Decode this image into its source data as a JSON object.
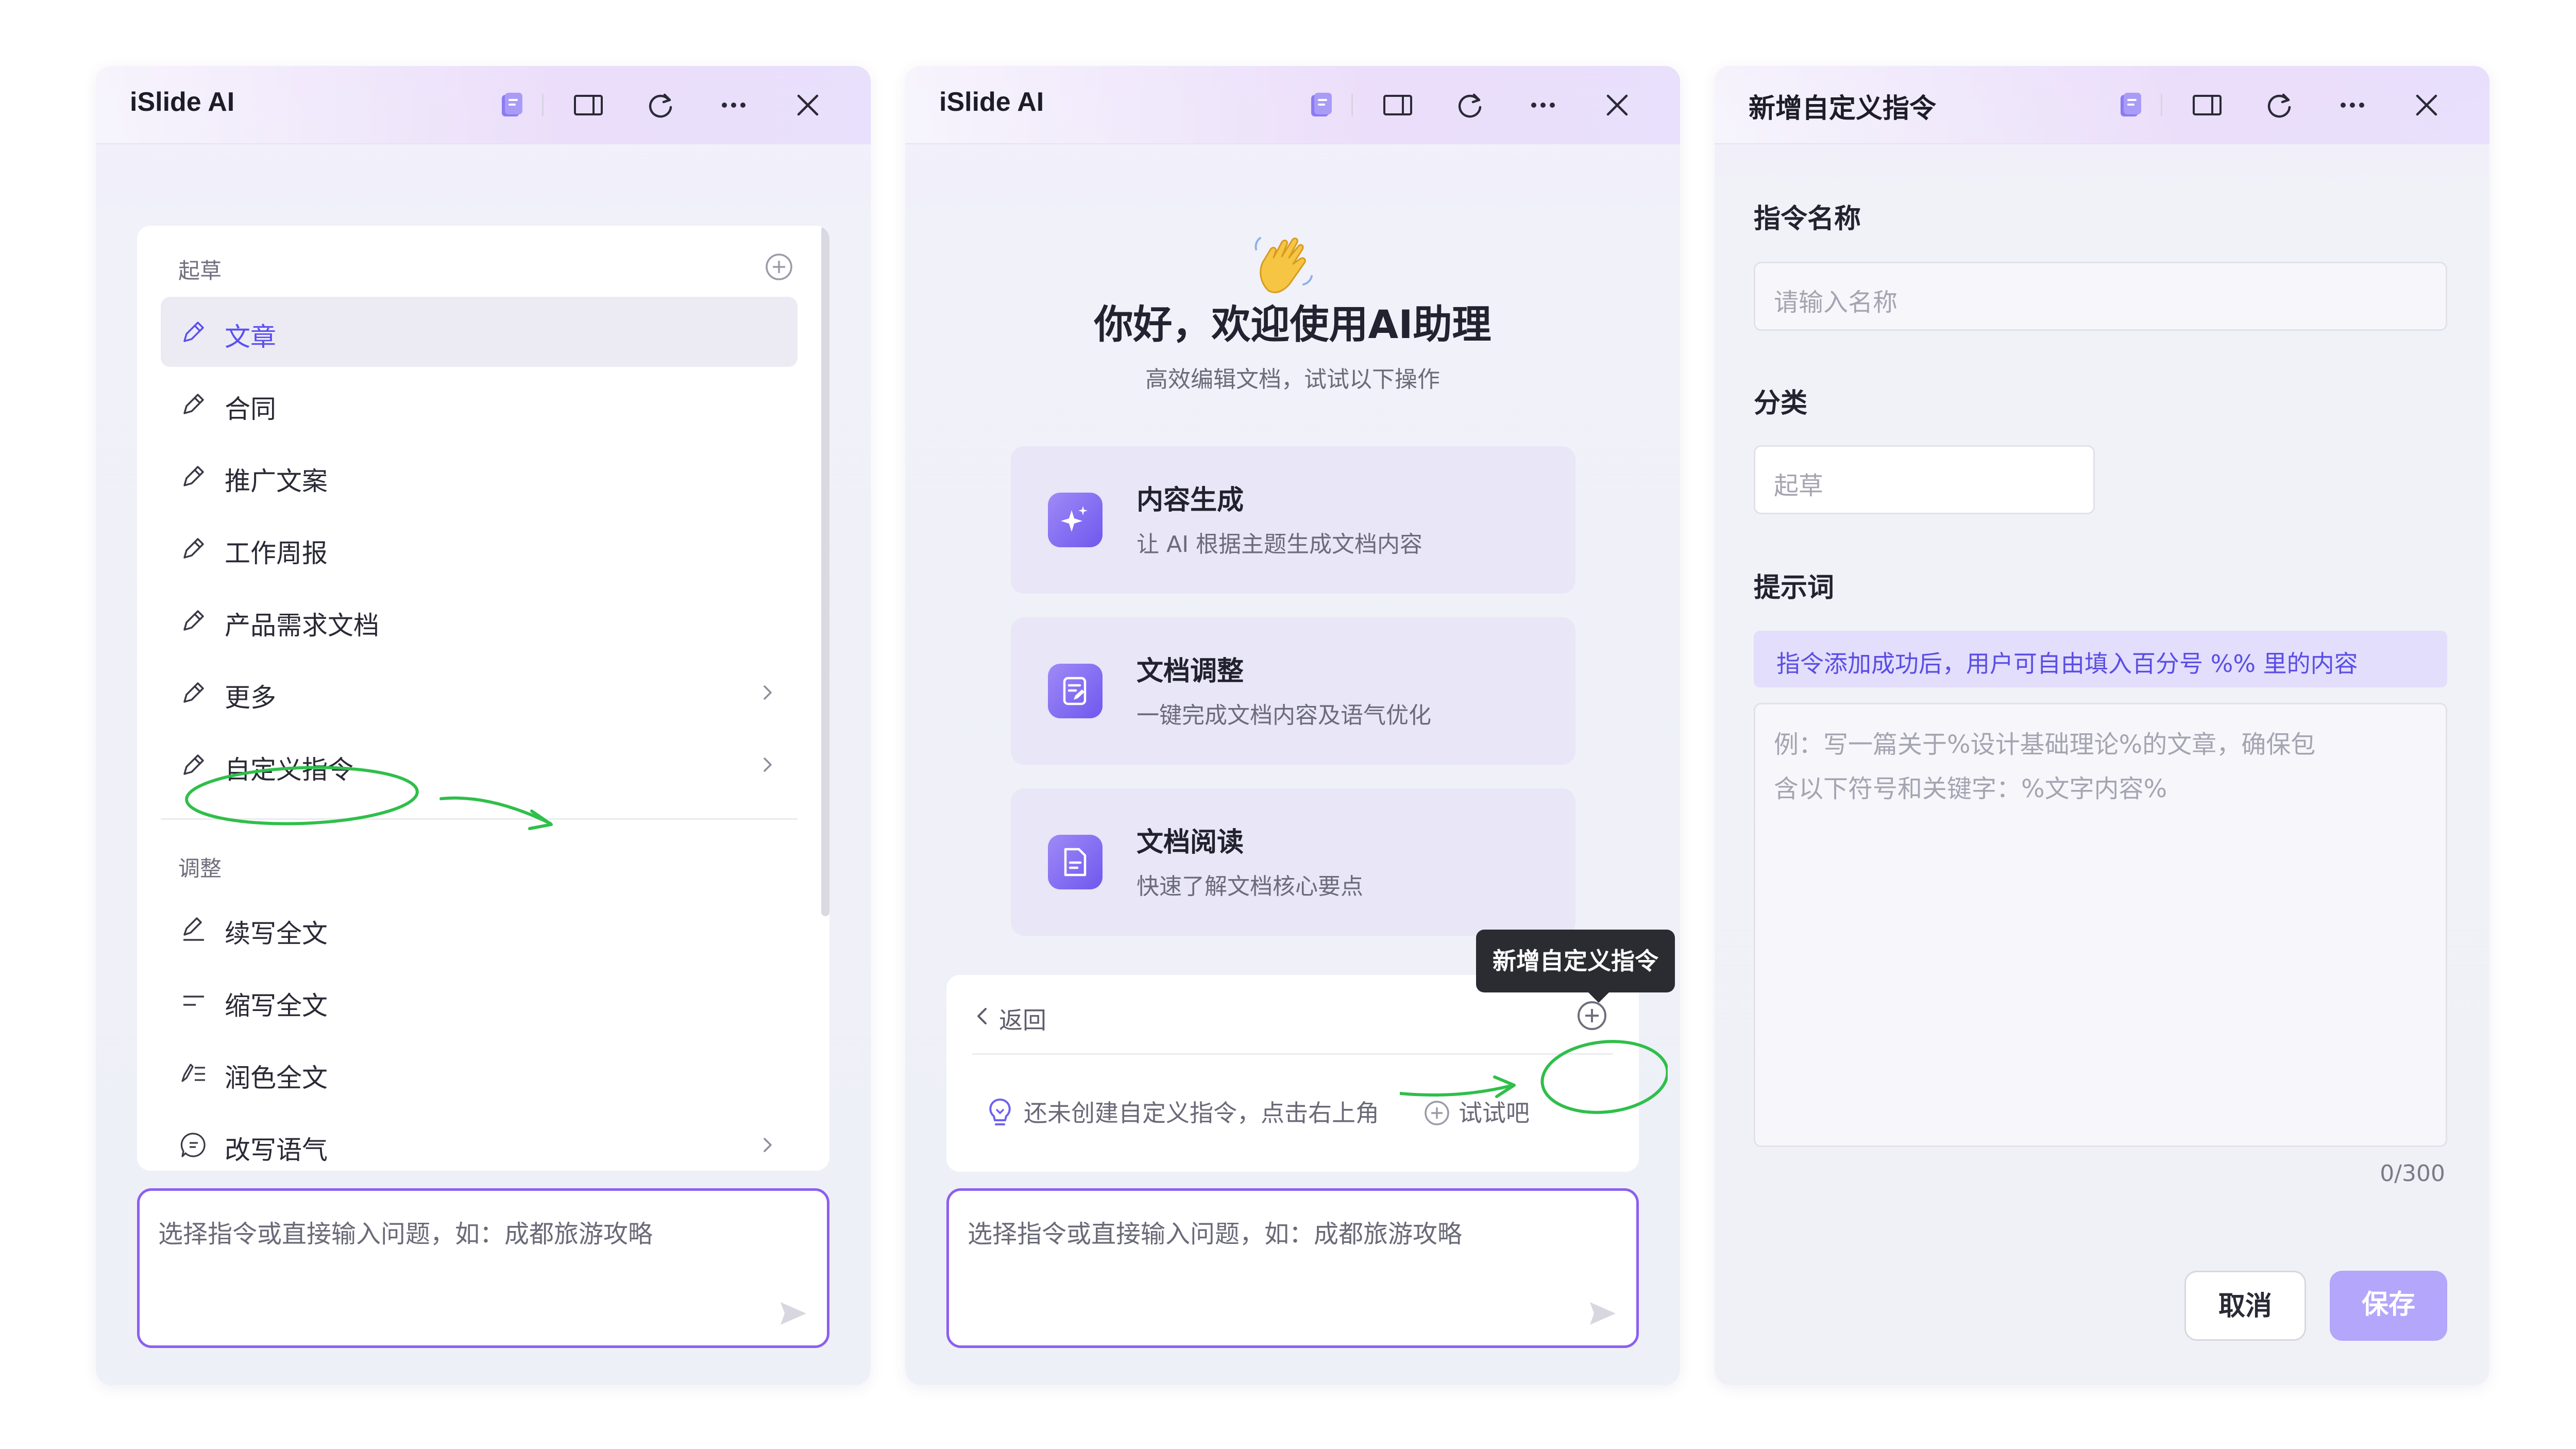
{
  "panels": [
    {
      "title": "iSlide AI",
      "sections": [
        {
          "label": "起草",
          "items": [
            "文章",
            "合同",
            "推广文案",
            "工作周报",
            "产品需求文档",
            "更多",
            "自定义指令"
          ]
        },
        {
          "label": "调整",
          "items": [
            "续写全文",
            "缩写全文",
            "润色全文",
            "改写语气"
          ]
        }
      ],
      "input_placeholder": "选择指令或直接输入问题，如：成都旅游攻略"
    },
    {
      "title": "iSlide AI",
      "welcome": {
        "emoji": "👋",
        "title": "你好，欢迎使用AI助理",
        "subtitle": "高效编辑文档，试试以下操作"
      },
      "features": [
        {
          "title": "内容生成",
          "desc": "让 AI 根据主题生成文档内容",
          "icon": "sparkle-icon"
        },
        {
          "title": "文档调整",
          "desc": "一键完成文档内容及语气优化",
          "icon": "edit-document-icon"
        },
        {
          "title": "文档阅读",
          "desc": "快速了解文档核心要点",
          "icon": "read-document-icon"
        }
      ],
      "tooltip": "新增自定义指令",
      "back_label": "返回",
      "empty_text_before": "还未创建自定义指令，点击右上角",
      "empty_text_after": "试试吧",
      "input_placeholder": "选择指令或直接输入问题，如：成都旅游攻略"
    },
    {
      "title": "新增自定义指令",
      "name_label": "指令名称",
      "name_placeholder": "请输入名称",
      "category_label": "分类",
      "category_value": "起草",
      "prompt_label": "提示词",
      "prompt_hint": "指令添加成功后，用户可自由填入百分号 %% 里的内容",
      "prompt_placeholder_line1": "例：写一篇关于%设计基础理论%的文章，确保包",
      "prompt_placeholder_line2": "含以下符号和关键字：%文字内容%",
      "counter": "0/300",
      "cancel_label": "取消",
      "save_label": "保存"
    }
  ],
  "colors": {
    "accent": "#5b4ff0",
    "input_border": "#8d5ef0",
    "annotation": "#2fbf4a",
    "save_button": "#b3a6fb"
  }
}
